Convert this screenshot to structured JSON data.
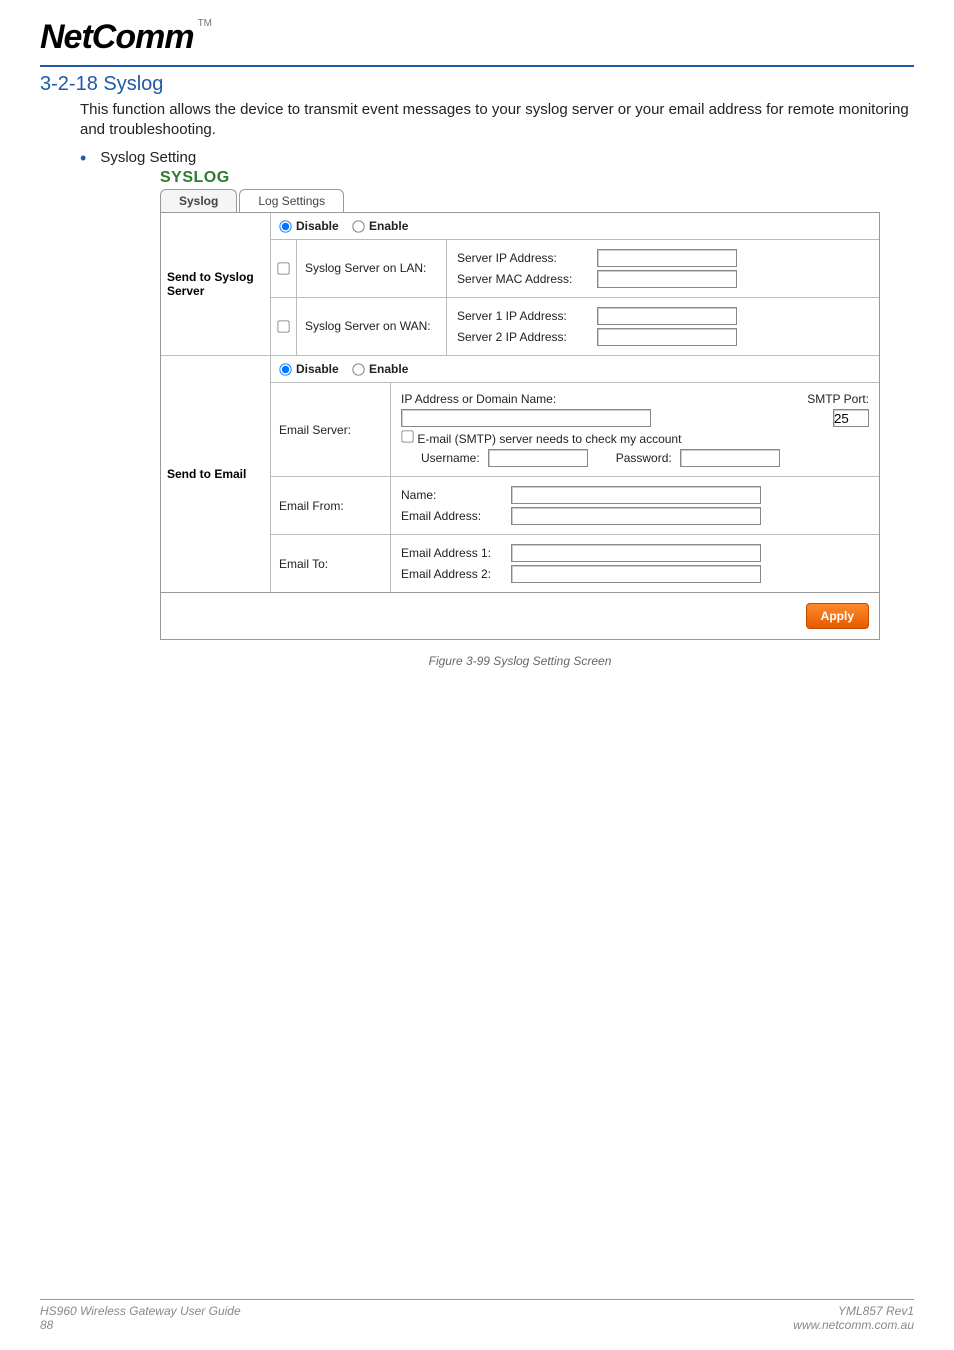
{
  "logo": {
    "text": "NetComm",
    "tm": "TM"
  },
  "section": {
    "number": "3-2-18",
    "title": "Syslog"
  },
  "intro": "This function allows the device to transmit event messages to your syslog server or your email address for remote monitoring and troubleshooting.",
  "bullet": "Syslog Setting",
  "panel": {
    "heading": "SYSLOG",
    "tabs": {
      "active": "Syslog",
      "inactive": "Log Settings"
    },
    "groups": [
      {
        "side": "Send to Syslog Server",
        "radio": {
          "disable": "Disable",
          "enable": "Enable"
        },
        "rows": [
          {
            "check": false,
            "label": "Syslog Server on LAN:",
            "fields": [
              {
                "label": "Server IP Address:",
                "value": ""
              },
              {
                "label": "Server MAC Address:",
                "value": ""
              }
            ]
          },
          {
            "check": false,
            "label": "Syslog Server on WAN:",
            "fields": [
              {
                "label": "Server 1 IP Address:",
                "value": ""
              },
              {
                "label": "Server 2 IP Address:",
                "value": ""
              }
            ]
          }
        ]
      },
      {
        "side": "Send to Email",
        "radio": {
          "disable": "Disable",
          "enable": "Enable"
        },
        "email_rows": [
          {
            "left": "Email Server:",
            "ip_label": "IP Address or Domain Name:",
            "smtp_label": "SMTP Port:",
            "smtp_value": "25",
            "check_label": "E-mail (SMTP) server needs to check my account",
            "user_label": "Username:",
            "pass_label": "Password:"
          },
          {
            "left": "Email From:",
            "name_label": "Name:",
            "addr_label": "Email Address:"
          },
          {
            "left": "Email To:",
            "a1_label": "Email Address 1:",
            "a2_label": "Email Address 2:"
          }
        ]
      }
    ],
    "apply": "Apply"
  },
  "caption": "Figure 3-99 Syslog Setting Screen",
  "footer": {
    "left1": "HS960 Wireless Gateway User Guide",
    "left2": "88",
    "right1": "YML857 Rev1",
    "right2": "www.netcomm.com.au"
  }
}
